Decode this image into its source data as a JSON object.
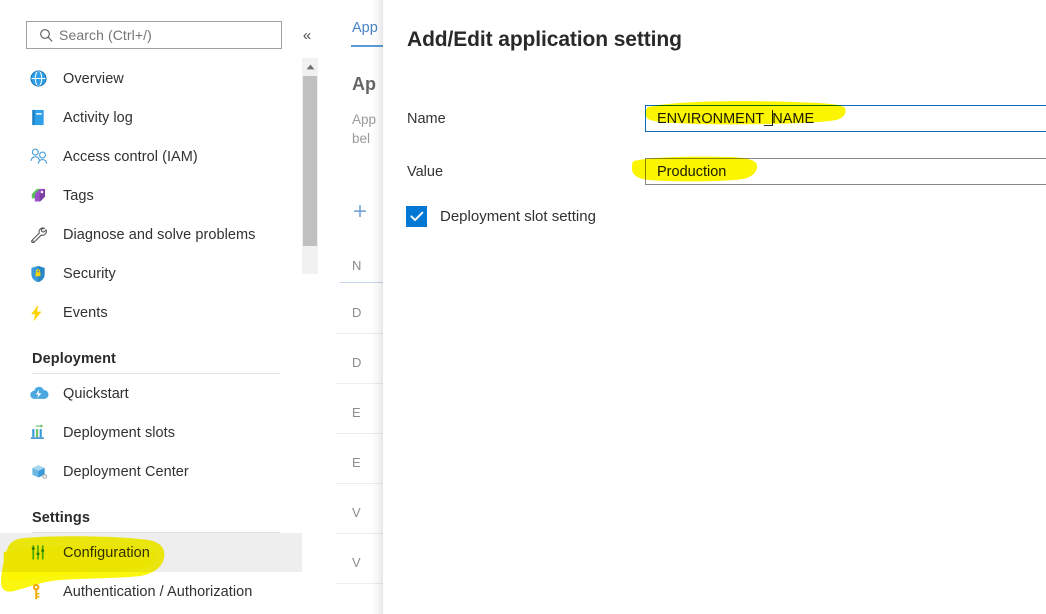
{
  "top_fragment": "Ap",
  "sidebar": {
    "search": {
      "placeholder": "Search (Ctrl+/)"
    },
    "collapse_label": "«",
    "items": [
      {
        "label": "Overview",
        "icon": "globe-icon",
        "selected": false
      },
      {
        "label": "Activity log",
        "icon": "book-icon",
        "selected": false
      },
      {
        "label": "Access control (IAM)",
        "icon": "people-icon",
        "selected": false
      },
      {
        "label": "Tags",
        "icon": "tags-icon",
        "selected": false
      },
      {
        "label": "Diagnose and solve problems",
        "icon": "wrench-icon",
        "selected": false
      },
      {
        "label": "Security",
        "icon": "shield-lock-icon",
        "selected": false
      },
      {
        "label": "Events",
        "icon": "lightning-icon",
        "selected": false
      }
    ],
    "sections": [
      {
        "title": "Deployment",
        "items": [
          {
            "label": "Quickstart",
            "icon": "cloud-icon",
            "selected": false
          },
          {
            "label": "Deployment slots",
            "icon": "bar-chart-icon",
            "selected": false
          },
          {
            "label": "Deployment Center",
            "icon": "box-icon",
            "selected": false
          }
        ]
      },
      {
        "title": "Settings",
        "items": [
          {
            "label": "Configuration",
            "icon": "sliders-icon",
            "selected": true
          },
          {
            "label": "Authentication / Authorization",
            "icon": "key-icon",
            "selected": false
          }
        ]
      }
    ]
  },
  "background_blade": {
    "tab_label": "App",
    "heading": "Ap",
    "description": "App\nbel",
    "add_label": "+",
    "column_header": "N",
    "rows": [
      "D",
      "D",
      "E",
      "E",
      "V",
      "V"
    ]
  },
  "dialog": {
    "title": "Add/Edit application setting",
    "name_label": "Name",
    "name_value_before_caret": "ENVIRONMENT_",
    "name_value_after_caret": "NAME",
    "value_label": "Value",
    "value_value": "Production",
    "checkbox_label": "Deployment slot setting",
    "checkbox_checked": true
  },
  "colors": {
    "accent_blue": "#0078d4",
    "focus_border": "#0f6cbd",
    "highlighter_yellow": "#fbf500",
    "selected_row_bg": "#eeeeee"
  }
}
